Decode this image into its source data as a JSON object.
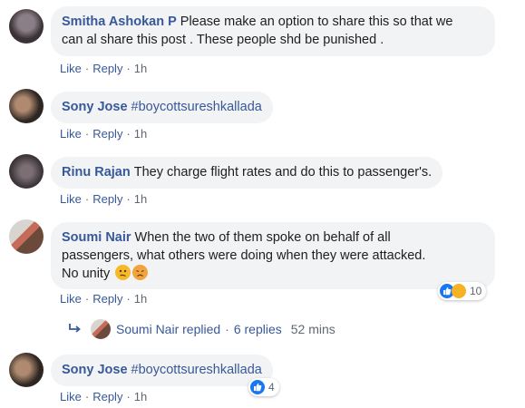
{
  "actions": {
    "like": "Like",
    "reply": "Reply",
    "time": "1h",
    "dot": "·"
  },
  "comments": [
    {
      "author": "Smitha Ashokan P",
      "text": "Please make an option to share this so that we",
      "text2": "can al share this post . These people shd be punished ."
    },
    {
      "author": "Sony Jose",
      "text": "#boycottsureshkallada"
    },
    {
      "author": "Rinu Rajan",
      "text": "They charge flight rates and do this to passenger's."
    },
    {
      "author": "Soumi Nair",
      "text": "When the two of them spoke on behalf of all",
      "text2": "passengers, what others were doing when they were attacked.",
      "text3": "No unity",
      "reaction_count": "10"
    },
    {
      "author": "Sony Jose",
      "text": "#boycottsureshkallada",
      "reaction_count": "4"
    }
  ],
  "replies": {
    "author": "Soumi Nair",
    "replied": "replied",
    "count": "6 replies",
    "time": "52 mins"
  },
  "icons": [
    "reply-arrow-icon",
    "like-reaction-icon",
    "sad-reaction-icon",
    "confused-emoji-icon",
    "sad-emoji-icon"
  ],
  "colors": {
    "link": "#385898",
    "bubble": "#f2f3f5",
    "meta": "#606770",
    "like": "#1877f2"
  }
}
